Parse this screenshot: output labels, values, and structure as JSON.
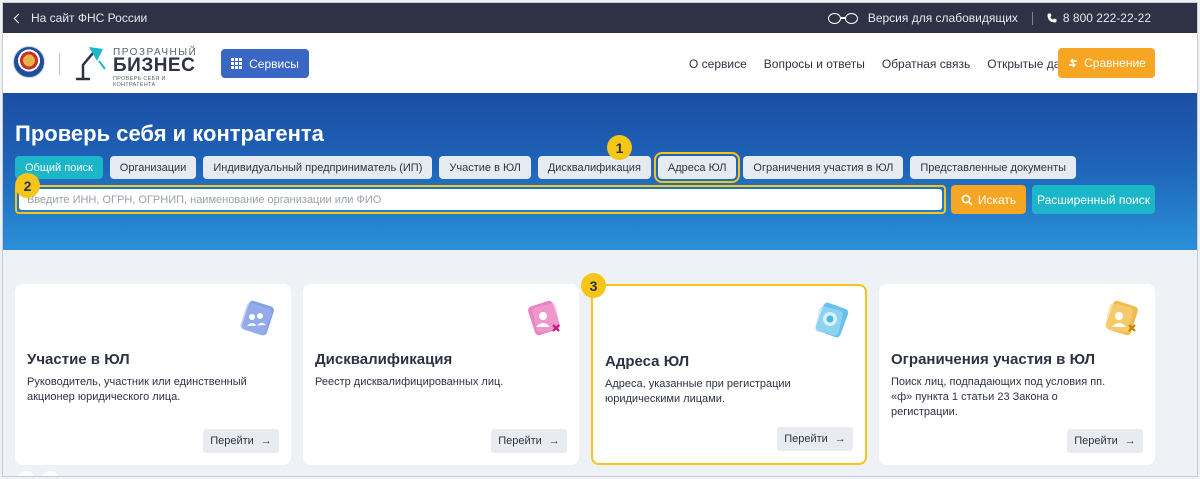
{
  "topbar": {
    "back_label": "На сайт ФНС России",
    "accessibility_label": "Версия для слабовидящих",
    "phone": "8 800 222-22-22"
  },
  "header": {
    "logo_line1": "ПРОЗРАЧНЫЙ",
    "logo_line2": "БИЗНЕС",
    "logo_line3": "ПРОВЕРЬ СЕБЯ И КОНТРАГЕНТА",
    "services_label": "Сервисы",
    "nav": [
      "О сервисе",
      "Вопросы и ответы",
      "Обратная связь",
      "Открытые данные"
    ],
    "compare_label": "Сравнение"
  },
  "hero": {
    "title": "Проверь себя и контрагента",
    "tabs": [
      "Общий поиск",
      "Организации",
      "Индивидуальный предприниматель (ИП)",
      "Участие в ЮЛ",
      "Дисквалификация",
      "Адреса ЮЛ",
      "Ограничения участия в ЮЛ",
      "Представленные документы"
    ],
    "search_placeholder": "Введите ИНН, ОГРН, ОГРНИП, наименование организации или ФИО",
    "search_button": "Искать",
    "advanced_button": "Расширенный поиск"
  },
  "badges": [
    "1",
    "2",
    "3"
  ],
  "cards": [
    {
      "title": "Участие в ЮЛ",
      "desc": "Руководитель, участник или единственный акционер юридического лица.",
      "button": "Перейти"
    },
    {
      "title": "Дисквалификация",
      "desc": "Реестр дисквалифицированных лиц.",
      "button": "Перейти"
    },
    {
      "title": "Адреса ЮЛ",
      "desc": "Адреса, указанные при регистрации юридическими лицами.",
      "button": "Перейти"
    },
    {
      "title": "Ограничения участия в ЮЛ",
      "desc": "Поиск лиц, подпадающих под условия пп. «ф» пункта 1 статьи 23 Закона о регистрации.",
      "button": "Перейти"
    }
  ],
  "colors": {
    "accent_blue": "#3a66c4",
    "accent_orange": "#f6a623",
    "accent_teal": "#1bb6c7",
    "highlight_yellow": "#f5c518",
    "topbar_dark": "#2d3344"
  }
}
